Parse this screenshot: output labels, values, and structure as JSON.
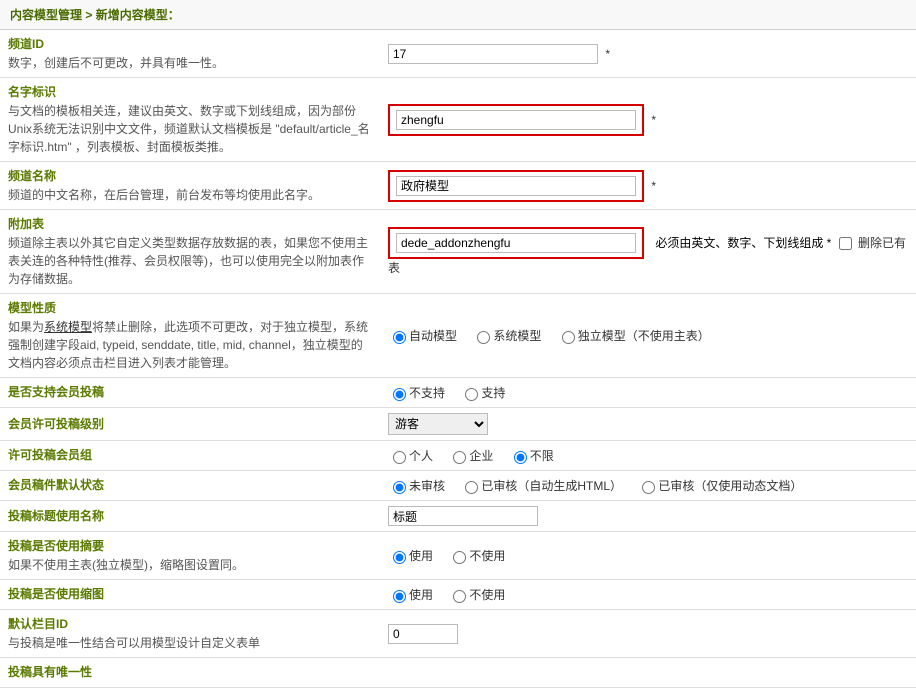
{
  "breadcrumb": {
    "part1": "内容模型管理",
    "sep": ">",
    "part2": "新增内容模型："
  },
  "rows": {
    "channel_id": {
      "title": "频道ID",
      "desc": "数字，创建后不可更改，并具有唯一性。",
      "value": "17",
      "req": "*"
    },
    "name_sign": {
      "title": "名字标识",
      "desc": "与文档的模板相关连，建议由英文、数字或下划线组成，因为部份Unix系统无法识别中文文件，频道默认文档模板是 \"default/article_名字标识.htm\" ，列表模板、封面模板类推。",
      "value": "zhengfu",
      "req": "*"
    },
    "channel_name": {
      "title": "频道名称",
      "desc": "频道的中文名称，在后台管理，前台发布等均使用此名字。",
      "value": "政府模型",
      "req": "*"
    },
    "addon_table": {
      "title": "附加表",
      "desc_before": "频道除主表以外其它自定义类型数据存放数据的表，如果您不使用主表关连的各种特性(推荐、会员权限等)，也可以使用完全以附加表作为存储数据。",
      "value": "dede_addonzhengfu",
      "hint": "必须由英文、数字、下划线组成 *",
      "check_label": "删除已有表"
    },
    "model_nature": {
      "title": "模型性质",
      "desc_pre": "如果为",
      "desc_link": "系统模型",
      "desc_post": "将禁止删除，此选项不可更改，对于独立模型，系统强制创建字段aid, typeid, senddate, title, mid, channel，独立模型的文档内容必须点击栏目进入列表才能管理。",
      "opt_auto": "自动模型",
      "opt_sys": "系统模型",
      "opt_ind": "独立模型（不使用主表）"
    },
    "member_post": {
      "title": "是否支持会员投稿",
      "opt_no": "不支持",
      "opt_yes": "支持"
    },
    "member_level": {
      "title": "会员许可投稿级别",
      "selected": "游客"
    },
    "member_group": {
      "title": "许可投稿会员组",
      "opt_personal": "个人",
      "opt_company": "企业",
      "opt_unlimited": "不限"
    },
    "default_status": {
      "title": "会员稿件默认状态",
      "opt_unreview": "未审核",
      "opt_reviewed_html": "已审核（自动生成HTML）",
      "opt_reviewed_dyn": "已审核（仅使用动态文档）"
    },
    "title_name": {
      "title": "投稿标题使用名称",
      "value": "标题"
    },
    "use_summary": {
      "title": "投稿是否使用摘要",
      "desc": "如果不使用主表(独立模型)，缩略图设置同。",
      "opt_use": "使用",
      "opt_not": "不使用"
    },
    "use_thumb": {
      "title": "投稿是否使用缩图",
      "opt_use": "使用",
      "opt_not": "不使用"
    },
    "default_column": {
      "title": "默认栏目ID",
      "desc": "与投稿是唯一性结合可以用模型设计自定义表单",
      "value": "0"
    },
    "unique": {
      "title": "投稿具有唯一性"
    }
  }
}
